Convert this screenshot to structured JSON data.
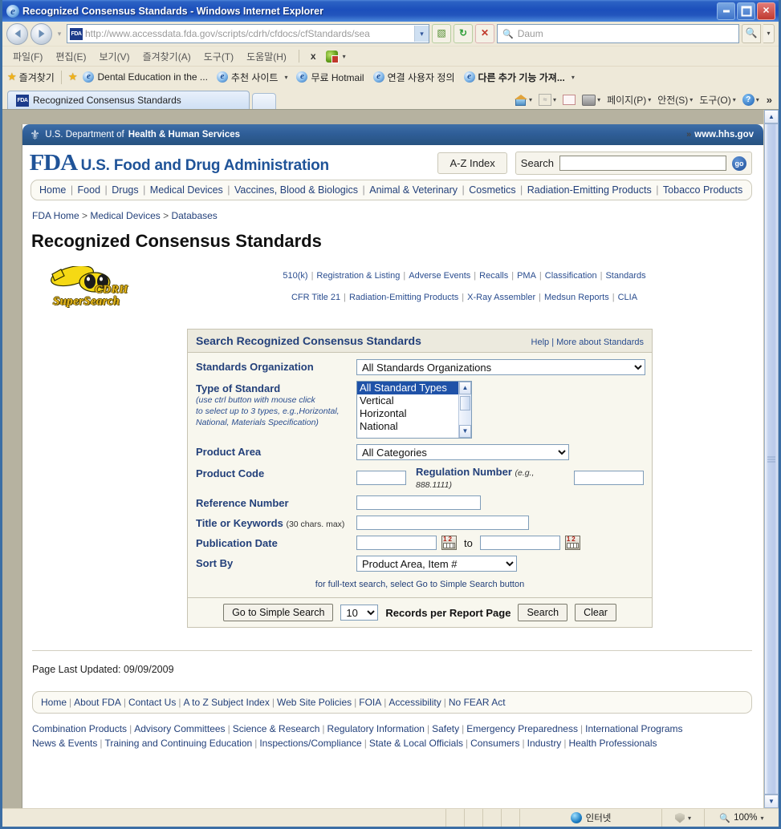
{
  "window": {
    "title": "Recognized Consensus Standards - Windows Internet Explorer",
    "minimize_label": "Minimize",
    "maximize_label": "Maximize",
    "close_label": "Close"
  },
  "browser": {
    "address": {
      "url": "http://www.accessdata.fda.gov/scripts/cdrh/cfdocs/cfStandards/sea",
      "favicon_label": "FDA"
    },
    "search": {
      "placeholder": "Daum",
      "value": ""
    },
    "menu": [
      "파일(F)",
      "편집(E)",
      "보기(V)",
      "즐겨찾기(A)",
      "도구(T)",
      "도움말(H)"
    ],
    "menu_close_label": "x",
    "favorites_bar": {
      "button_label": "즐겨찾기",
      "items": [
        "Dental Education in the ...",
        "추천 사이트",
        "무료 Hotmail",
        "연결 사용자 정의",
        "다른 추가 기능 가져..."
      ]
    },
    "tabs": [
      {
        "label": "Recognized Consensus Standards"
      }
    ],
    "command_bar": [
      "페이지(P)",
      "안전(S)",
      "도구(O)"
    ],
    "overflow_label": "»"
  },
  "status_bar": {
    "zone": "인터넷",
    "zoom": "100%"
  },
  "page": {
    "hhs": {
      "text_prefix": "U.S. Department of ",
      "text_bold": "Health & Human Services",
      "link": "www.hhs.gov"
    },
    "fda": {
      "logo_mark": "FDA",
      "agency_name": "U.S. Food and Drug Administration",
      "az_index": "A-Z Index",
      "search_label": "Search",
      "search_value": "",
      "go_label": "go"
    },
    "main_nav": [
      "Home",
      "Food",
      "Drugs",
      "Medical Devices",
      "Vaccines, Blood & Biologics",
      "Animal & Veterinary",
      "Cosmetics",
      "Radiation-Emitting Products",
      "Tobacco Products"
    ],
    "breadcrumb": [
      "FDA Home",
      "Medical Devices",
      "Databases"
    ],
    "title": "Recognized Consensus Standards",
    "supersearch": {
      "line1": "CDRH",
      "line2": "SuperSearch"
    },
    "sublinks_row1": [
      "510(k)",
      "Registration & Listing",
      "Adverse Events",
      "Recalls",
      "PMA",
      "Classification",
      "Standards"
    ],
    "sublinks_row2": [
      "CFR Title 21",
      "Radiation-Emitting Products",
      "X-Ray Assembler",
      "Medsun Reports",
      "CLIA"
    ],
    "panel": {
      "heading": "Search Recognized Consensus Standards",
      "help_link": "Help",
      "more_link": "More about Standards",
      "fields": {
        "org_label": "Standards Organization",
        "org_value": "All Standards Organizations",
        "type_label": "Type of Standard",
        "type_hint_line1": "(use ctrl button with mouse click",
        "type_hint_line2": "to select up to 3 types, e.g.,Horizontal,",
        "type_hint_line3": "National, Materials Specification)",
        "type_options": [
          "All Standard Types",
          "Vertical",
          "Horizontal",
          "National"
        ],
        "type_selected": "All Standard Types",
        "product_area_label": "Product Area",
        "product_area_value": "All Categories",
        "product_code_label": "Product Code",
        "product_code_value": "",
        "regulation_label": "Regulation Number",
        "regulation_example": "(e.g., 888.1111)",
        "regulation_value": "",
        "reference_label": "Reference Number",
        "reference_value": "",
        "title_label": "Title or Keywords",
        "title_hint": "(30 chars. max)",
        "title_value": "",
        "pubdate_label": "Publication Date",
        "pubdate_from": "",
        "pubdate_to": "",
        "pubdate_to_word": "to",
        "sort_label": "Sort By",
        "sort_value": "Product Area, Item #",
        "fulltext_note": "for full-text search, select Go to Simple Search button"
      },
      "footer": {
        "simple_search_btn": "Go to Simple Search",
        "records_value": "10",
        "records_label": "Records per Report Page",
        "search_btn": "Search",
        "clear_btn": "Clear"
      }
    },
    "last_updated": "Page Last Updated: 09/09/2009",
    "footer_nav": [
      "Home",
      "About FDA",
      "Contact Us",
      "A to Z Subject Index",
      "Web Site Policies",
      "FOIA",
      "Accessibility",
      "No FEAR Act"
    ],
    "footer_links_row1": [
      "Combination Products",
      "Advisory Committees",
      "Science & Research",
      "Regulatory Information",
      "Safety",
      "Emergency Preparedness",
      "International Programs"
    ],
    "footer_links_row2": [
      "News & Events",
      "Training and Continuing Education",
      "Inspections/Compliance",
      "State & Local Officials",
      "Consumers",
      "Industry",
      "Health Professionals"
    ]
  },
  "colors": {
    "title_blue": "#1c4fbb",
    "hhs_blue": "#2f5e98",
    "fda_blue": "#1f5398",
    "link_blue": "#23407a",
    "panel_bg": "#f8f7ee",
    "panel_head": "#eceade",
    "select_highlight": "#1f52a8",
    "supersearch_gold": "#e8b81e"
  }
}
